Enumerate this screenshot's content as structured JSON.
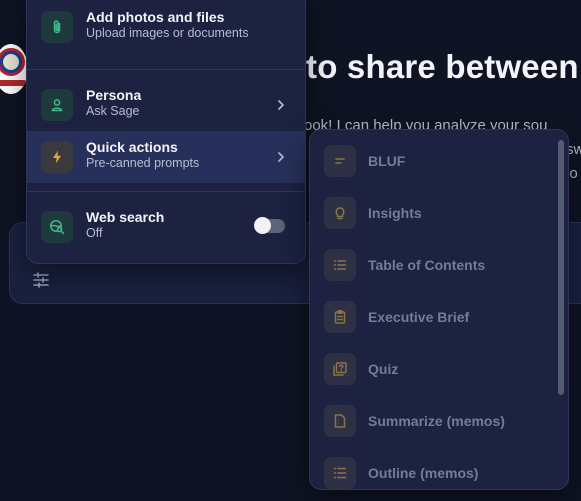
{
  "background": {
    "heading": "to share between",
    "lines": [
      "ook! I can help you analyze your sou",
      "sw",
      "lo"
    ]
  },
  "menu": {
    "items": [
      {
        "title": "Add photos and files",
        "subtitle": "Upload images or documents",
        "icon": "paperclip-icon"
      },
      {
        "title": "Persona",
        "subtitle": "Ask Sage",
        "icon": "person-icon"
      },
      {
        "title": "Quick actions",
        "subtitle": "Pre-canned prompts",
        "icon": "lightning-icon"
      },
      {
        "title": "Web search",
        "subtitle": "Off",
        "icon": "globe-search-icon"
      }
    ],
    "web_search_enabled": false
  },
  "quick_actions": {
    "items": [
      {
        "label": "BLUF",
        "icon": "lines-icon"
      },
      {
        "label": "Insights",
        "icon": "lightbulb-icon"
      },
      {
        "label": "Table of Contents",
        "icon": "list-icon"
      },
      {
        "label": "Executive Brief",
        "icon": "clipboard-icon"
      },
      {
        "label": "Quiz",
        "icon": "quiz-icon"
      },
      {
        "label": "Summarize (memos)",
        "icon": "document-icon"
      },
      {
        "label": "Outline (memos)",
        "icon": "outline-icon"
      }
    ]
  },
  "colors": {
    "accent_green": "#3fb98a",
    "accent_amber": "#e0a93a",
    "icon_muted_amber": "#8a7444"
  }
}
